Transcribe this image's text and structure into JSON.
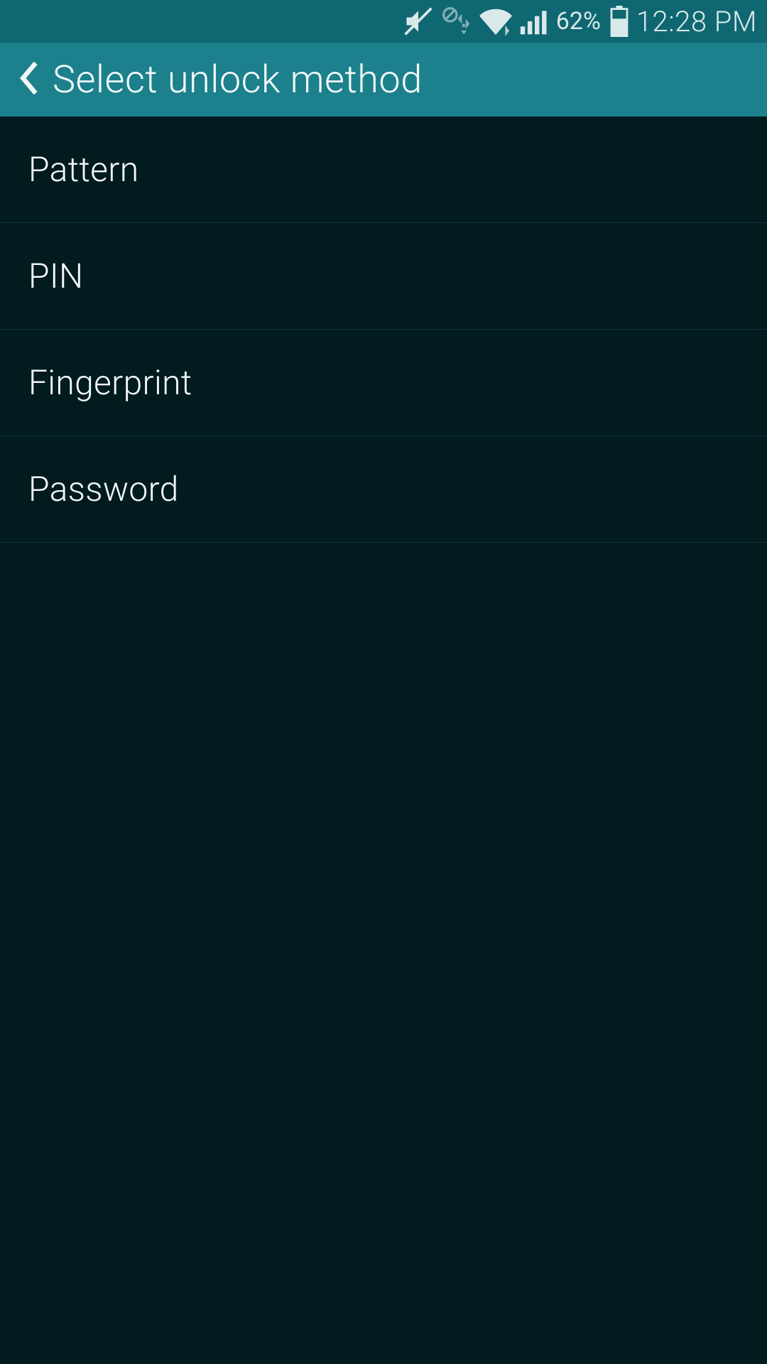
{
  "status_bar": {
    "battery_percent": "62%",
    "time": "12:28 PM"
  },
  "app_bar": {
    "title": "Select unlock method"
  },
  "options": [
    {
      "label": "Pattern"
    },
    {
      "label": "PIN"
    },
    {
      "label": "Fingerprint"
    },
    {
      "label": "Password"
    }
  ]
}
